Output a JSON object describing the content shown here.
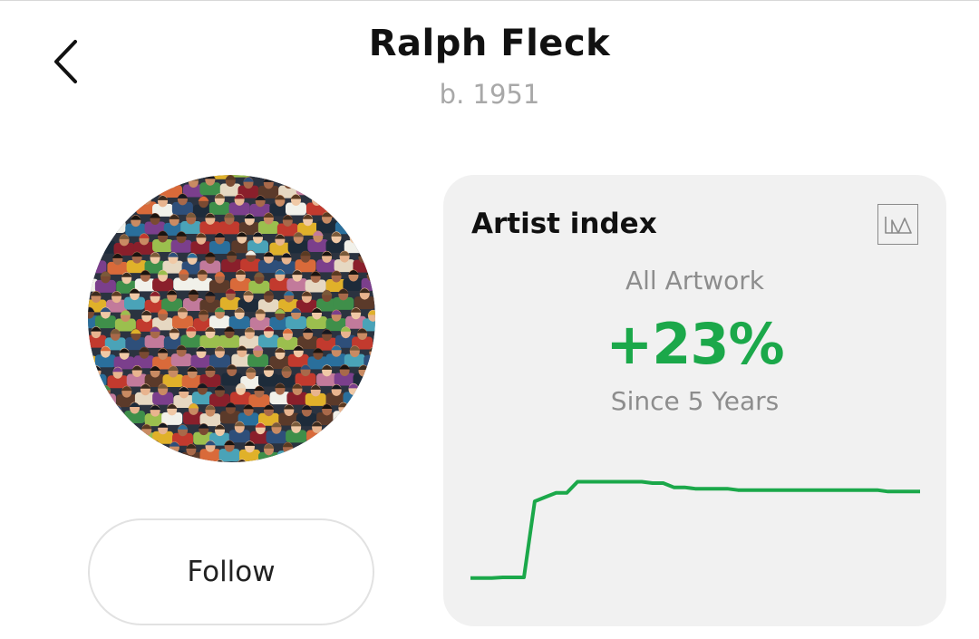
{
  "header": {
    "back_icon": "chevron-left-icon",
    "artist_name": "Ralph Fleck",
    "born": "b. 1951"
  },
  "profile": {
    "avatar_description_icon": "artwork-crowd-painting",
    "follow_label": "Follow"
  },
  "artist_index": {
    "title": "Artist index",
    "toggle_icon": "chart-mountain-icon",
    "subset": "All Artwork",
    "change": "+23%",
    "period": "Since 5 Years",
    "accent_color": "#1ba84a"
  },
  "chart_data": {
    "type": "line",
    "title": "",
    "xlabel": "",
    "ylabel": "",
    "grid": false,
    "ylim": [
      0,
      100
    ],
    "series": [
      {
        "color": "#1ba84a",
        "values": [
          6,
          6,
          6,
          6.5,
          6.5,
          6.5,
          61,
          64,
          67,
          67,
          75,
          75,
          75,
          75,
          75,
          75,
          75,
          74,
          74,
          71,
          71,
          70,
          70,
          70,
          70,
          69,
          69,
          69,
          69,
          69,
          69,
          69,
          69,
          69,
          69,
          69,
          69,
          69,
          69,
          68,
          68,
          68,
          68
        ]
      }
    ]
  }
}
